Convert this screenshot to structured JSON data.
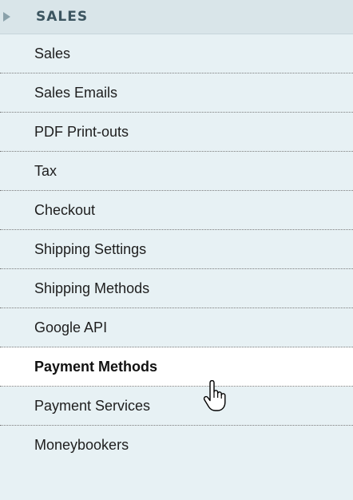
{
  "section": {
    "title": "SALES",
    "arrow_icon": "triangle-right-icon"
  },
  "menu": {
    "items": [
      {
        "label": "Sales"
      },
      {
        "label": "Sales Emails"
      },
      {
        "label": "PDF Print-outs"
      },
      {
        "label": "Tax"
      },
      {
        "label": "Checkout"
      },
      {
        "label": "Shipping Settings"
      },
      {
        "label": "Shipping Methods"
      },
      {
        "label": "Google API"
      },
      {
        "label": "Payment Methods",
        "active": true
      },
      {
        "label": "Payment Services"
      },
      {
        "label": "Moneybookers"
      }
    ]
  },
  "cursor_icon": "hand-pointer-icon",
  "colors": {
    "background": "#e7f1f4",
    "header": "#d9e5e9",
    "header_text": "#3c5560",
    "active_bg": "#ffffff"
  }
}
